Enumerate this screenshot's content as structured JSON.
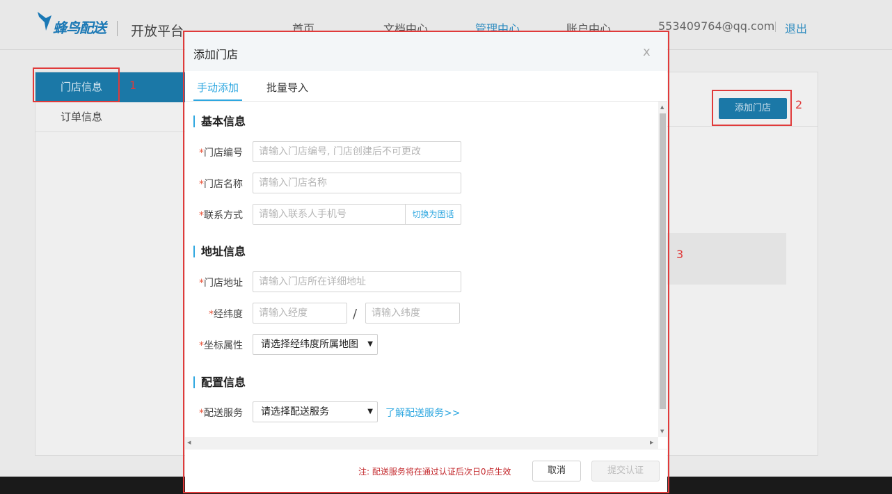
{
  "header": {
    "logo_text": "蜂鸟配送",
    "platform": "开放平台",
    "nav": [
      "首页",
      "文档中心",
      "管理中心",
      "账户中心"
    ],
    "active_nav": "管理中心",
    "account": "553409764@qq.com",
    "logout": "退出"
  },
  "sidebar": {
    "items": [
      {
        "label": "门店信息",
        "active": true
      },
      {
        "label": "订单信息",
        "active": false
      }
    ]
  },
  "main": {
    "add_store_button": "添加门店"
  },
  "annotations": [
    "1",
    "2",
    "3"
  ],
  "modal": {
    "title": "添加门店",
    "close": "x",
    "tabs": [
      {
        "label": "手动添加",
        "active": true
      },
      {
        "label": "批量导入",
        "active": false
      }
    ],
    "sections": {
      "basic": "基本信息",
      "address": "地址信息",
      "config": "配置信息"
    },
    "fields": {
      "store_id": {
        "label": "门店编号",
        "placeholder": "请输入门店编号, 门店创建后不可更改"
      },
      "store_name": {
        "label": "门店名称",
        "placeholder": "请输入门店名称"
      },
      "contact": {
        "label": "联系方式",
        "placeholder": "请输入联系人手机号",
        "switch": "切换为固话"
      },
      "store_address": {
        "label": "门店地址",
        "placeholder": "请输入门店所在详细地址"
      },
      "lnglat": {
        "label": "经纬度",
        "lng_placeholder": "请输入经度",
        "lat_placeholder": "请输入纬度",
        "separator": "/"
      },
      "coord_type": {
        "label": "坐标属性",
        "value": "请选择经纬度所属地图"
      },
      "delivery": {
        "label": "配送服务",
        "value": "请选择配送服务",
        "link": "了解配送服务>>"
      }
    },
    "required_mark": "*",
    "footer": {
      "note": "注: 配送服务将在通过认证后次日0点生效",
      "cancel": "取消",
      "submit": "提交认证"
    }
  },
  "colors": {
    "accent": "#2ea7e0",
    "brand_dark": "#1b78a7",
    "annotation_red": "#e03a3a",
    "note_red": "#c3282c"
  }
}
